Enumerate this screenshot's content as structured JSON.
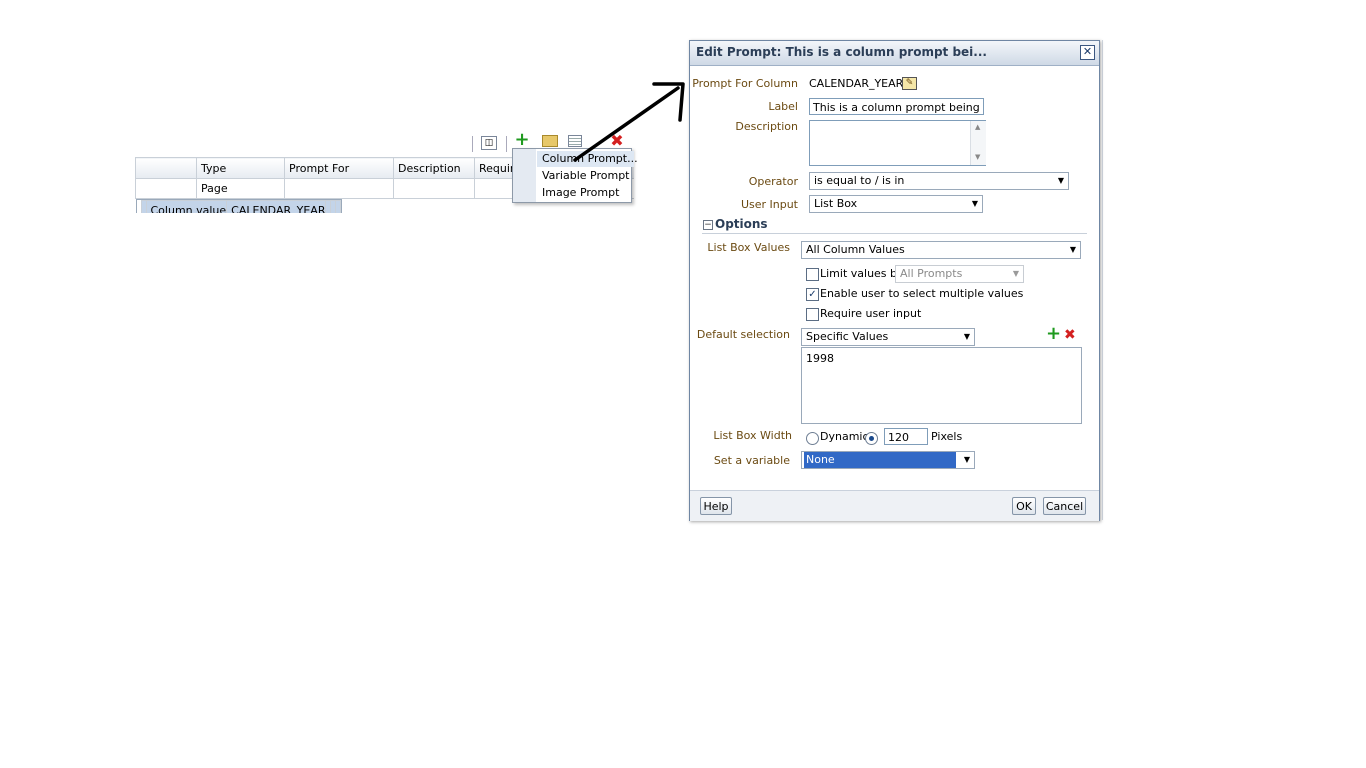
{
  "grid": {
    "columns": [
      "",
      "Type",
      "Prompt For",
      "Description",
      "Require",
      ""
    ],
    "rows": [
      [
        "",
        "Page",
        "",
        "",
        "",
        ""
      ],
      [
        "",
        "Column value",
        "CALENDAR_YEAR",
        "",
        "",
        ""
      ]
    ]
  },
  "toolbar": {
    "preview_icon": "preview-icon",
    "new_icon": "add-prompt-icon",
    "insert_page_icon": "insert-page-icon",
    "layout_icon": "layout-icon",
    "delete_icon": "delete-icon"
  },
  "context_menu": {
    "items": [
      "Column Prompt...",
      "Variable Prompt",
      "Image Prompt"
    ]
  },
  "dialog": {
    "title": "Edit Prompt: This is a column prompt bei...",
    "prompt_for_column_label": "Prompt For Column",
    "prompt_for_column_value": "CALENDAR_YEAR",
    "label_label": "Label",
    "label_value": "This is a column prompt being built c",
    "description_label": "Description",
    "description_value": "",
    "operator_label": "Operator",
    "operator_value": "is equal to / is in",
    "user_input_label": "User Input",
    "user_input_value": "List Box",
    "options_header": "Options",
    "list_box_values_label": "List Box Values",
    "list_box_values_value": "All Column Values",
    "limit_values_label": "Limit values by",
    "limit_values_value": "All Prompts",
    "limit_values_checked": false,
    "multi_select_label": "Enable user to select multiple values",
    "multi_select_checked": true,
    "require_input_label": "Require user input",
    "require_input_checked": false,
    "default_selection_label": "Default selection",
    "default_selection_value": "Specific Values",
    "default_values": [
      "1998"
    ],
    "list_box_width_label": "List Box Width",
    "width_dynamic_label": "Dynamic",
    "width_mode": "pixels",
    "width_value": "120",
    "width_unit": "Pixels",
    "set_variable_label": "Set a variable",
    "set_variable_value": "None",
    "help_button": "Help",
    "ok_button": "OK",
    "cancel_button": "Cancel"
  }
}
